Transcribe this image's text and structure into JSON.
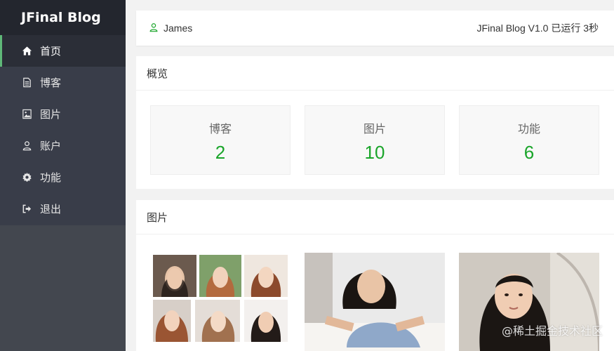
{
  "brand": "JFinal Blog",
  "nav": [
    {
      "label": "首页",
      "icon": "home-icon",
      "active": true
    },
    {
      "label": "博客",
      "icon": "document-icon",
      "active": false
    },
    {
      "label": "图片",
      "icon": "image-icon",
      "active": false
    },
    {
      "label": "账户",
      "icon": "user-icon",
      "active": false
    },
    {
      "label": "功能",
      "icon": "gear-icon",
      "active": false
    },
    {
      "label": "退出",
      "icon": "logout-icon",
      "active": false
    }
  ],
  "header": {
    "user": "James",
    "status": "JFinal Blog V1.0 已运行 3秒"
  },
  "overview": {
    "title": "概览",
    "stats": [
      {
        "label": "博客",
        "value": "2"
      },
      {
        "label": "图片",
        "value": "10"
      },
      {
        "label": "功能",
        "value": "6"
      }
    ]
  },
  "pictures": {
    "title": "图片"
  },
  "watermark": "@稀土掘金技术社区",
  "colors": {
    "sidebar": "#393d49",
    "brand_bg": "#23262e",
    "accent": "#5fb878",
    "stat_value": "#1aa52a"
  }
}
